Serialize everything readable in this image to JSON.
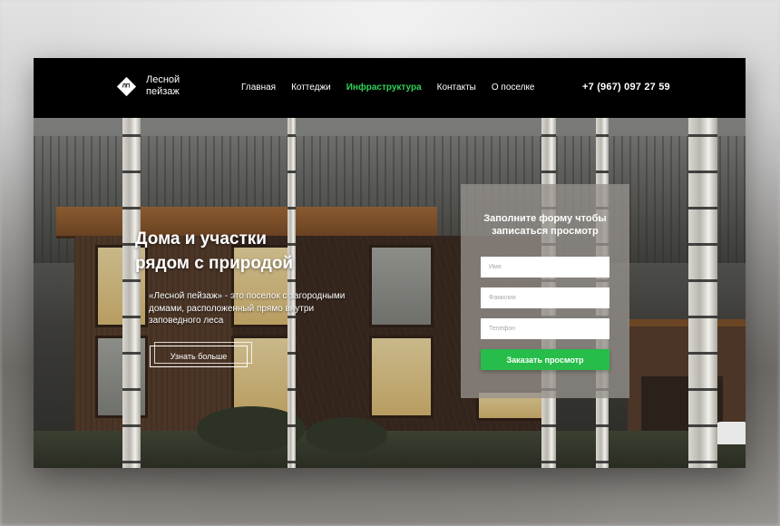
{
  "header": {
    "logo_text_line1": "Лесной",
    "logo_text_line2": "пейзаж",
    "logo_mark": "ЛП",
    "nav": [
      {
        "label": "Главная",
        "active": false
      },
      {
        "label": "Коттеджи",
        "active": false
      },
      {
        "label": "Инфраструктура",
        "active": true
      },
      {
        "label": "Контакты",
        "active": false
      },
      {
        "label": "О поселке",
        "active": false
      }
    ],
    "phone": "+7 (967) 097 27 59"
  },
  "hero": {
    "title_line1": "Дома и участки",
    "title_line2": "рядом с природой",
    "description": "«Лесной пейзаж» - это поселок с загородными домами, расположенный прямо внутри заповедного леса",
    "more_button": "Узнать больше"
  },
  "form": {
    "title": "Заполните форму чтобы записаться просмотр",
    "fields": {
      "name_placeholder": "Имя",
      "surname_placeholder": "Фамилия",
      "phone_placeholder": "Телефон"
    },
    "submit_label": "Заказать просмотр"
  },
  "colors": {
    "accent_green": "#27bd4a",
    "nav_active": "#2fd25a",
    "header_bg": "#000000"
  }
}
